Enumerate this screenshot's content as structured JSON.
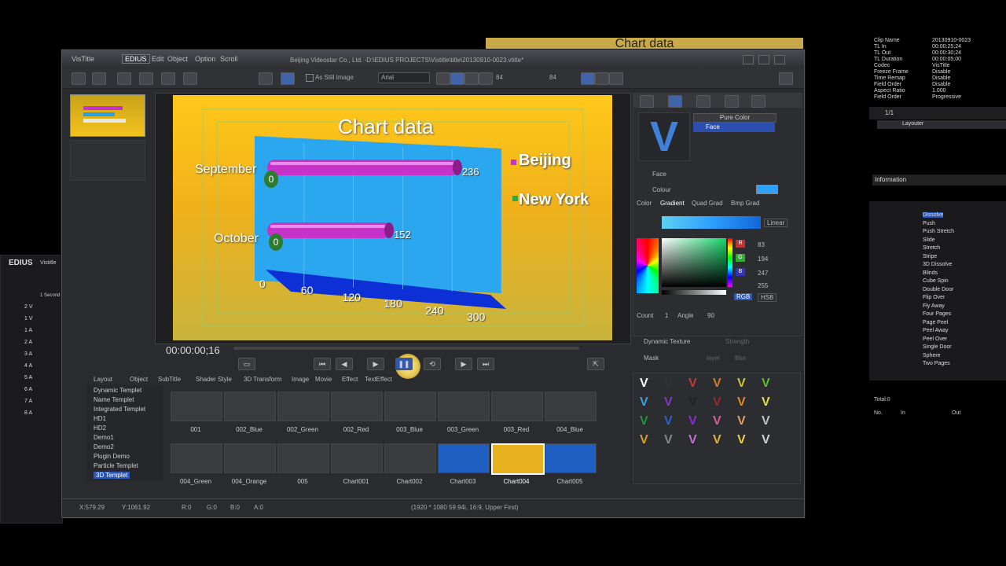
{
  "window": {
    "app_name": "VisTitle",
    "menus": [
      "EDIUS",
      "Edit",
      "Object",
      "Option",
      "Scroll"
    ],
    "title": "Beijing Videostar Co., Ltd. -D:\\EDIUS PROJECTS\\Vistitle\\title\\20130910-0023.vtitle*",
    "as_still_image": "As Still Image",
    "font_name": "Arial",
    "font_size": "84",
    "font_size2": "84"
  },
  "banner_text": "Chart data",
  "chart_data": {
    "type": "bar",
    "title": "Chart data",
    "categories": [
      "September",
      "October"
    ],
    "series": [
      {
        "name": "Beijing",
        "values": [
          236,
          152
        ],
        "color": "#c533c8"
      },
      {
        "name": "New York",
        "values": [
          0,
          0
        ],
        "color": "#2ea84b"
      }
    ],
    "xlim": [
      0,
      300
    ],
    "xticks": [
      "0",
      "60",
      "120",
      "180",
      "240",
      "300"
    ],
    "legend_placement": "right",
    "background": "#f0b21b"
  },
  "transport": {
    "timecode": "00:00:00;16"
  },
  "right_panel": {
    "pure_color": "Pure Color",
    "face_item": "Face",
    "face_label": "Face",
    "colour_label": "Colour",
    "color_tabs": [
      "Color",
      "Gradient",
      "Quad Grad",
      "Bmp Grad"
    ],
    "linear": "Linear",
    "r_val": "83",
    "g_val": "194",
    "b_val": "247",
    "a_val": "255",
    "rgb_btn": "RGB",
    "hsb_btn": "HSB",
    "count_label": "Count",
    "count_val": "1",
    "angle_label": "Angle",
    "angle_val": "90",
    "dynamic_texture": "Dynamic Texture",
    "mask": "Mask",
    "strength": "Strength",
    "layer": "layer",
    "blur": "Blur"
  },
  "gallery": {
    "tabs": [
      "Layout",
      "Object",
      "SubTitle",
      "Shader Style",
      "3D Transform",
      "Image",
      "Movie",
      "Effect",
      "TextEffect"
    ],
    "tree": [
      "Dynamic Templet",
      "Name Templet",
      "Integrated Templet",
      "HD1",
      "HD2",
      "Demo1",
      "Demo2",
      "Plugin Demo",
      "Particle Templet",
      "3D Templet"
    ],
    "row1": [
      "001",
      "002_Blue",
      "002_Green",
      "002_Red",
      "003_Blue",
      "003_Green",
      "003_Red",
      "004_Blue"
    ],
    "row2": [
      "004_Green",
      "004_Orange",
      "005",
      "Chart001",
      "Chart002",
      "Chart003",
      "Chart004",
      "Chart005"
    ]
  },
  "status": {
    "x": "X:579.29",
    "y": "Y:1061.92",
    "r": "R:0",
    "g": "G:0",
    "b": "B:0",
    "a": "A:0",
    "format": "(1920 * 1080 59.94i, 16:9, Upper First)"
  },
  "info_panel": {
    "rows": [
      {
        "k": "Clip Name",
        "v": "20130910-0023"
      },
      {
        "k": "TL In",
        "v": "00:00:25;24"
      },
      {
        "k": "TL Out",
        "v": "00:00:30;24"
      },
      {
        "k": "TL Duration",
        "v": "00:00:05;00"
      },
      {
        "k": "Codec",
        "v": "VisTitle"
      },
      {
        "k": "Freeze Frame",
        "v": "Disable"
      },
      {
        "k": "Time Remap",
        "v": "Disable"
      },
      {
        "k": "Field Order",
        "v": "Disable"
      },
      {
        "k": "Aspect Ratio",
        "v": "1.000"
      },
      {
        "k": "Field Order",
        "v": "Progressive"
      }
    ],
    "page": "1/1",
    "layouter": "Layouter",
    "information": "Information",
    "total": "Total:0",
    "cols": [
      "No.",
      "In",
      "Out"
    ]
  },
  "effects_tree": [
    "Dissolve",
    "Push",
    "Push Stretch",
    "Slide",
    "Stretch",
    "Stripe",
    "3D Dissolve",
    "Blinds",
    "Cube Spin",
    "Double Door",
    "Flip Over",
    "Fly Away",
    "Four Pages",
    "Page Peel",
    "Peel Away",
    "Peel Over",
    "Single Door",
    "Sphere",
    "Two Pages"
  ],
  "edius_left": {
    "brand": "EDIUS",
    "tab": "Vistitle",
    "second": "1 Second",
    "tracks": [
      "2 V",
      "1 V",
      "1 A",
      "2 A",
      "3 A",
      "4 A",
      "5 A",
      "6 A",
      "7 A",
      "8 A"
    ]
  }
}
